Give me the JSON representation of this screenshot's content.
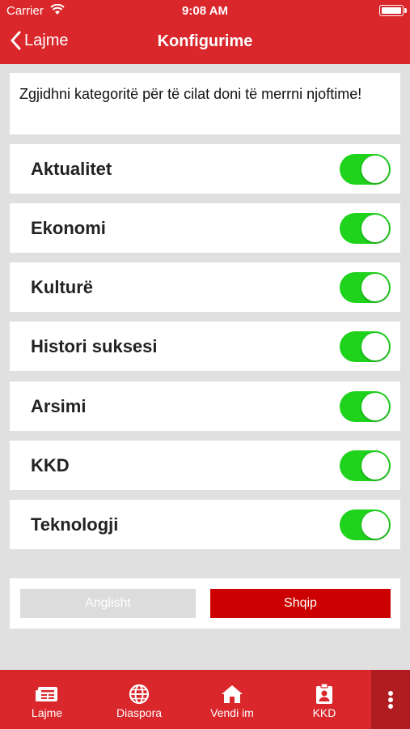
{
  "status": {
    "carrier": "Carrier",
    "time": "9:08 AM"
  },
  "nav": {
    "back_label": "Lajme",
    "title": "Konfigurime"
  },
  "intro": "Zgjidhni kategoritë për të cilat doni të merrni njoftime!",
  "categories": [
    {
      "label": "Aktualitet",
      "enabled": true
    },
    {
      "label": "Ekonomi",
      "enabled": true
    },
    {
      "label": "Kulturë",
      "enabled": true
    },
    {
      "label": "Histori suksesi",
      "enabled": true
    },
    {
      "label": "Arsimi",
      "enabled": true
    },
    {
      "label": "KKD",
      "enabled": true
    },
    {
      "label": "Teknologji",
      "enabled": true
    }
  ],
  "language": {
    "english": "Anglisht",
    "albanian": "Shqip",
    "selected": "albanian"
  },
  "tabs": [
    {
      "label": "Lajme",
      "icon": "newspaper-icon"
    },
    {
      "label": "Diaspora",
      "icon": "globe-icon"
    },
    {
      "label": "Vendi im",
      "icon": "home-icon"
    },
    {
      "label": "KKD",
      "icon": "id-badge-icon"
    }
  ],
  "colors": {
    "brand_red": "#d9272b",
    "toggle_on": "#1fd31d",
    "selected_lang": "#cc0000"
  }
}
